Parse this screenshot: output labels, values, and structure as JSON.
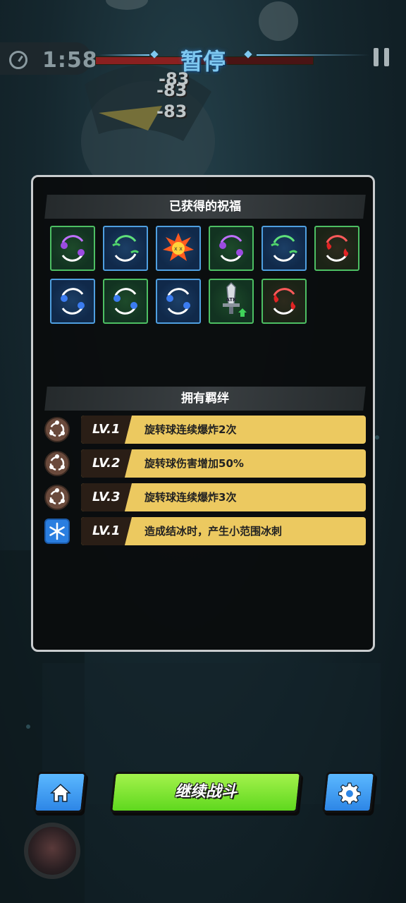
{
  "hud": {
    "timer": "1:58",
    "title": "暂停",
    "boss_health_fraction": 0.4,
    "damage_numbers": [
      "-83",
      "-83",
      "-83"
    ]
  },
  "blessings": {
    "title": "已获得的祝福",
    "items": [
      {
        "icon": "purple-skull-orbit-icon",
        "frame": "green"
      },
      {
        "icon": "green-wind-orbit-icon",
        "frame": "blue"
      },
      {
        "icon": "explosion-skull-icon",
        "frame": "blue"
      },
      {
        "icon": "purple-skull-orbit-icon",
        "frame": "green"
      },
      {
        "icon": "green-wind-orbit-icon",
        "frame": "blue"
      },
      {
        "icon": "red-fire-orbit-icon",
        "frame": "green"
      },
      {
        "icon": "blue-ice-orbit-icon",
        "frame": "blue"
      },
      {
        "icon": "blue-ice-orbit-icon",
        "frame": "green"
      },
      {
        "icon": "blue-ice-orbit-icon",
        "frame": "blue"
      },
      {
        "icon": "atk-sword-up-icon",
        "frame": "green",
        "label": "ATK"
      },
      {
        "icon": "red-fire-orbit-icon",
        "frame": "green"
      }
    ]
  },
  "bonds": {
    "title": "拥有羁绊",
    "items": [
      {
        "icon": "orbit-ball-icon",
        "level": "LV.1",
        "text": "旋转球连续爆炸2次"
      },
      {
        "icon": "orbit-ball-icon",
        "level": "LV.2",
        "text": "旋转球伤害增加50%"
      },
      {
        "icon": "orbit-ball-icon",
        "level": "LV.3",
        "text": "旋转球连续爆炸3次"
      },
      {
        "icon": "snowflake-icon",
        "level": "LV.1",
        "text": "造成结冰时，产生小范围冰刺"
      }
    ]
  },
  "buttons": {
    "continue": "继续战斗",
    "home_icon": "home-icon",
    "settings_icon": "gear-icon"
  },
  "colors": {
    "panel_border": "#c9ccce",
    "bond_bar": "#ecc960",
    "continue_button": "#7be533",
    "side_buttons": "#3d9cf0",
    "title": "#7ec8f0"
  }
}
